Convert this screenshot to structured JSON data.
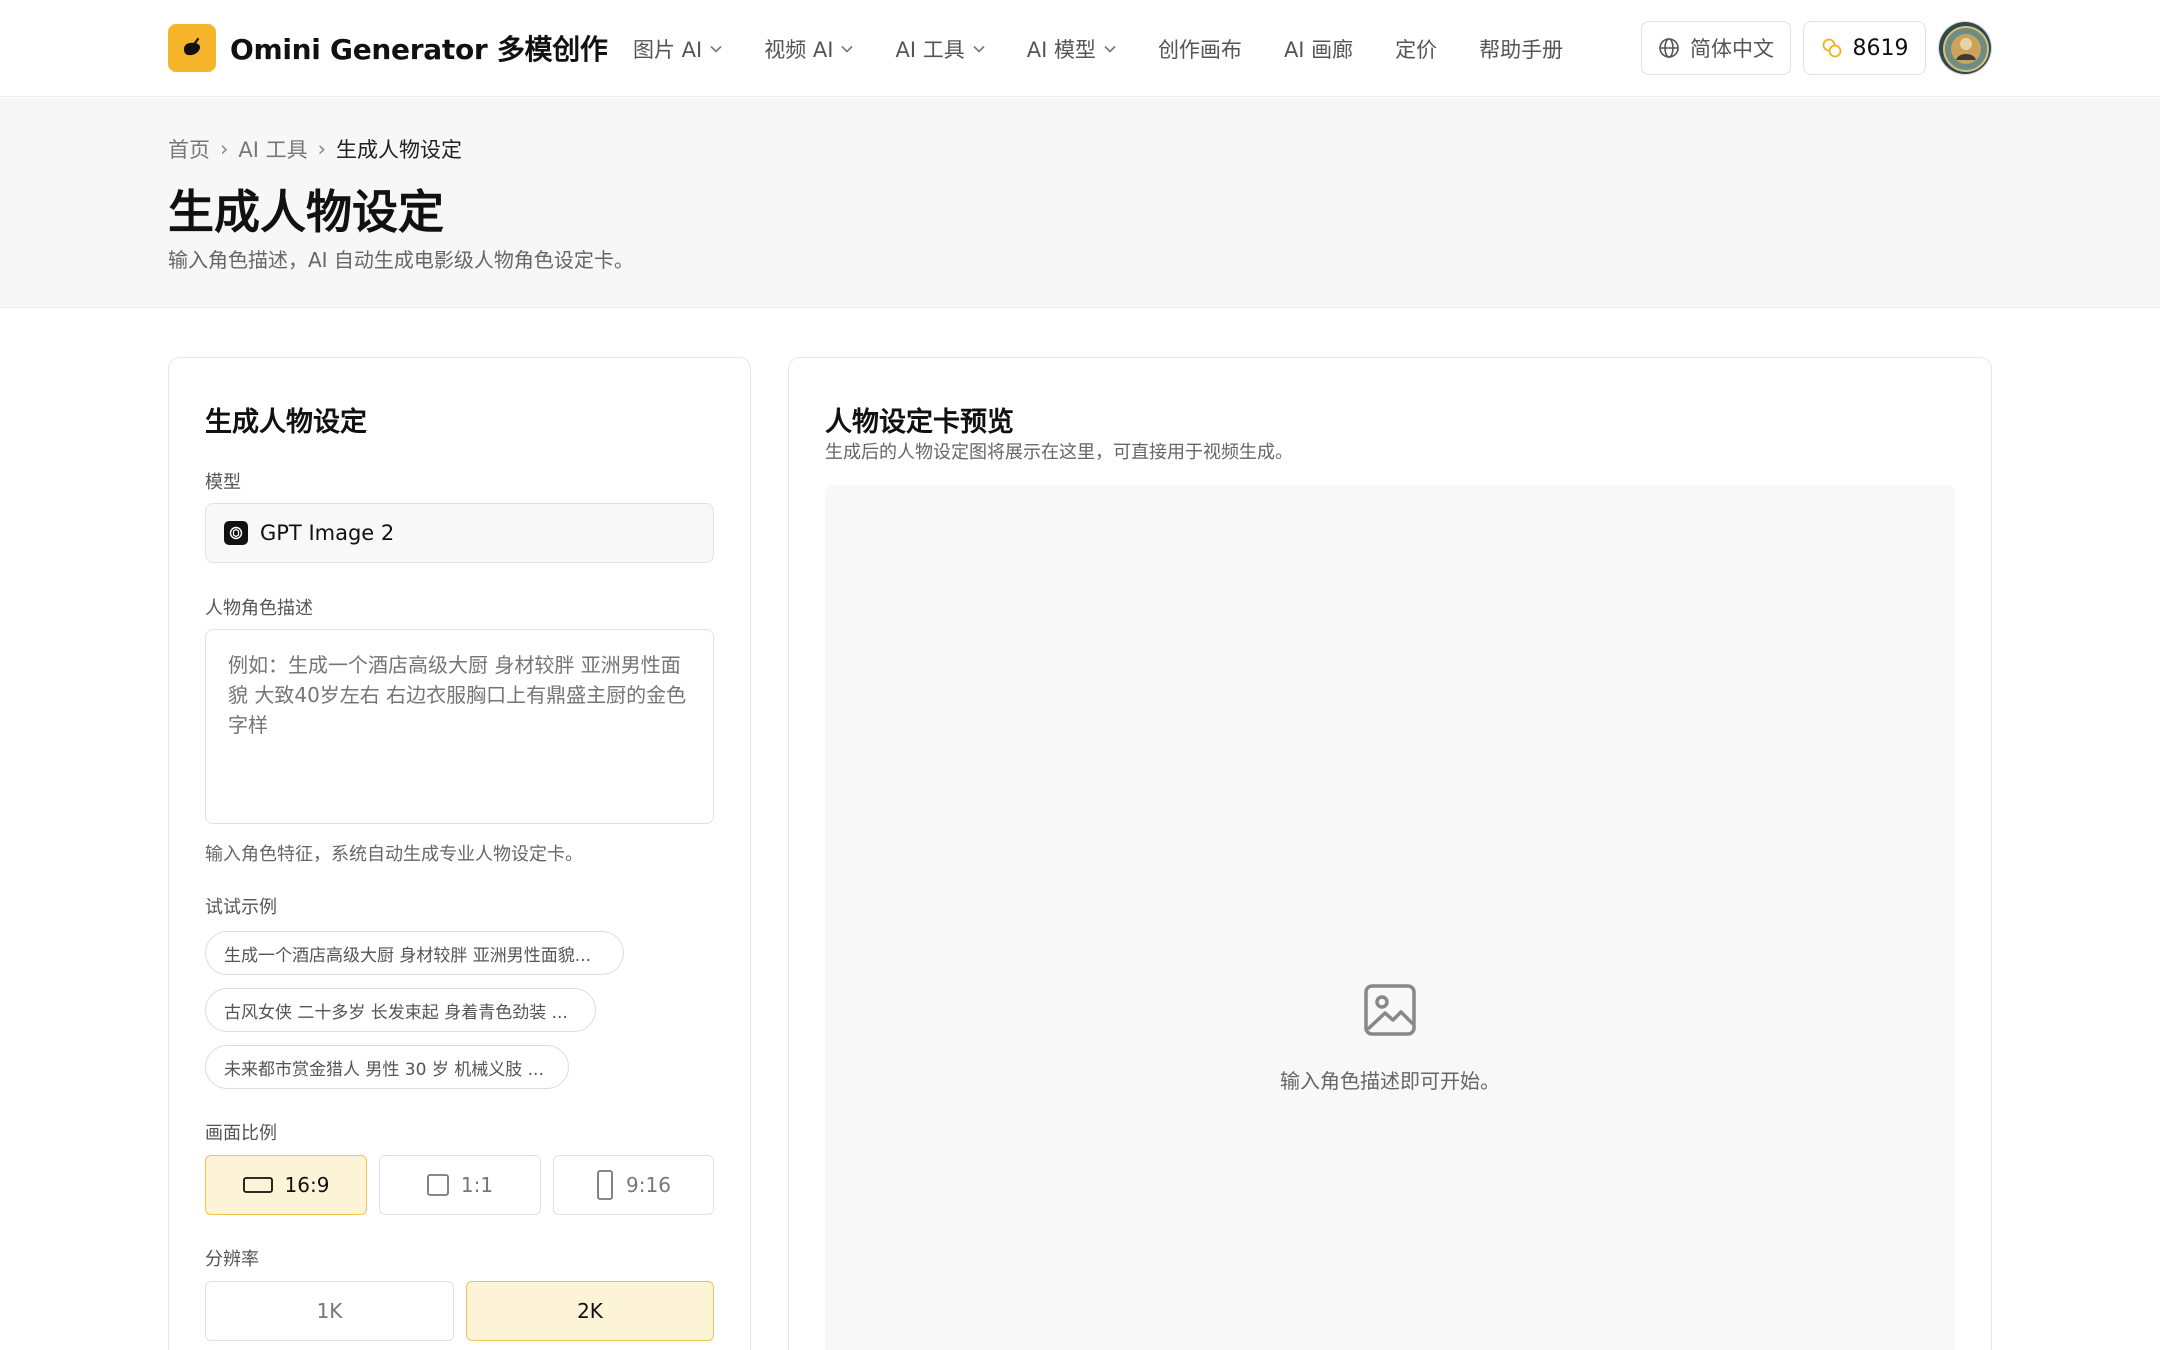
{
  "header": {
    "brand": "Omini Generator 多模创作",
    "nav": [
      {
        "label": "图片 AI",
        "dropdown": true
      },
      {
        "label": "视频 AI",
        "dropdown": true
      },
      {
        "label": "AI 工具",
        "dropdown": true
      },
      {
        "label": "AI 模型",
        "dropdown": true
      },
      {
        "label": "创作画布",
        "dropdown": false
      },
      {
        "label": "AI 画廊",
        "dropdown": false
      },
      {
        "label": "定价",
        "dropdown": false
      },
      {
        "label": "帮助手册",
        "dropdown": false
      }
    ],
    "language": "简体中文",
    "credits": "8619"
  },
  "breadcrumb": {
    "home": "首页",
    "section": "AI 工具",
    "current": "生成人物设定"
  },
  "hero": {
    "title": "生成人物设定",
    "subtitle": "输入角色描述，AI 自动生成电影级人物角色设定卡。"
  },
  "form": {
    "title": "生成人物设定",
    "model_label": "模型",
    "model_value": "GPT Image 2",
    "desc_label": "人物角色描述",
    "desc_placeholder": "例如：生成一个酒店高级大厨 身材较胖 亚洲男性面貌 大致40岁左右 右边衣服胸口上有鼎盛主厨的金色字样",
    "desc_hint": "输入角色特征，系统自动生成专业人物设定卡。",
    "examples_label": "试试示例",
    "examples": [
      "生成一个酒店高级大厨 身材较胖 亚洲男性面貌...",
      "古风女侠 二十多岁 长发束起 身着青色劲装 ...",
      "未来都市赏金猎人 男性 30 岁 机械义肢 ..."
    ],
    "ratio_label": "画面比例",
    "ratios": [
      {
        "label": "16:9",
        "selected": true
      },
      {
        "label": "1:1",
        "selected": false
      },
      {
        "label": "9:16",
        "selected": false
      }
    ],
    "resolution_label": "分辨率",
    "resolutions": [
      {
        "label": "1K",
        "selected": false
      },
      {
        "label": "2K",
        "selected": true
      }
    ]
  },
  "preview": {
    "title": "人物设定卡预览",
    "subtitle": "生成后的人物设定图将展示在这里，可直接用于视频生成。",
    "empty_text": "输入角色描述即可开始。"
  },
  "icons": {
    "logo": "banana-logo-icon",
    "language": "globe-icon",
    "credits": "coins-icon",
    "model": "openai-icon",
    "empty": "image-placeholder-icon"
  },
  "colors": {
    "accent": "#f7b52c",
    "selected_bg": "#fdf3d6",
    "selected_border": "#f2c54a"
  }
}
